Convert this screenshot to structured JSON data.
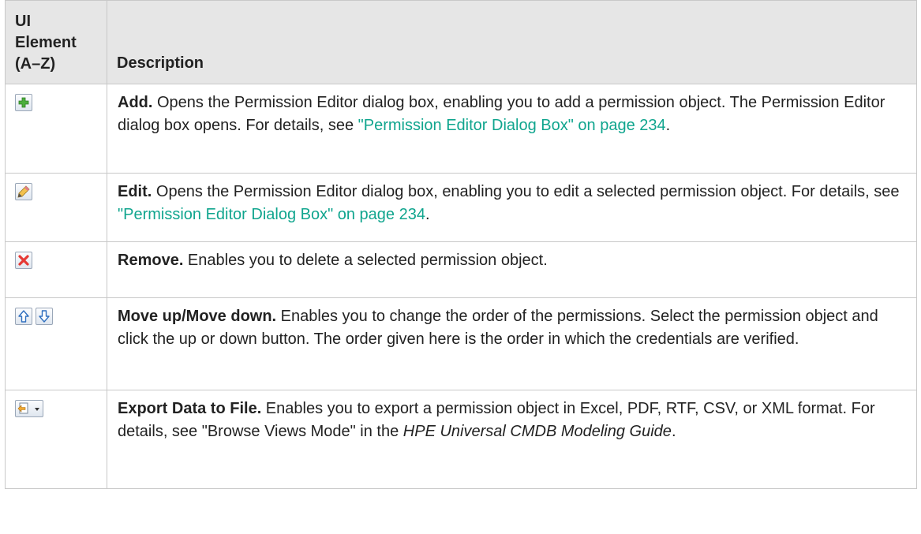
{
  "header": {
    "col1_line1": "UI",
    "col1_line2": "Element",
    "col1_line3": "(A–Z)",
    "col2": "Description"
  },
  "rows": [
    {
      "icon": "add-icon",
      "title": "Add.",
      "text": " Opens the Permission Editor dialog box, enabling you to add a permission object. The Permission Editor dialog box opens. For details, see ",
      "link": "\"Permission Editor Dialog Box\" on page 234",
      "end": "."
    },
    {
      "icon": "edit-pencil-icon",
      "title": "Edit.",
      "text": " Opens the Permission Editor dialog box, enabling you to edit a selected permission object. For details, see ",
      "link": "\"Permission Editor Dialog Box\" on page 234",
      "end": "."
    },
    {
      "icon": "remove-x-icon",
      "title": "Remove.",
      "text": " Enables you to delete a selected permission object."
    },
    {
      "icon": "move-up-icon, move-down-icon",
      "title": "Move up/Move down.",
      "text": " Enables you to change the order of the permissions. Select the permission object and click the up or down button. The order given here is the order in which the credentials are verified."
    },
    {
      "icon": "export-data-icon",
      "title": "Export Data to File.",
      "text": " Enables you to export a permission object in Excel, PDF, RTF, CSV, or XML format. For details, see \"Browse Views Mode\" in the ",
      "italic": "HPE Universal CMDB Modeling Guide",
      "end": "."
    }
  ],
  "colors": {
    "header_bg": "#e6e6e6",
    "border": "#c8c8c8",
    "link": "#10a58e"
  }
}
